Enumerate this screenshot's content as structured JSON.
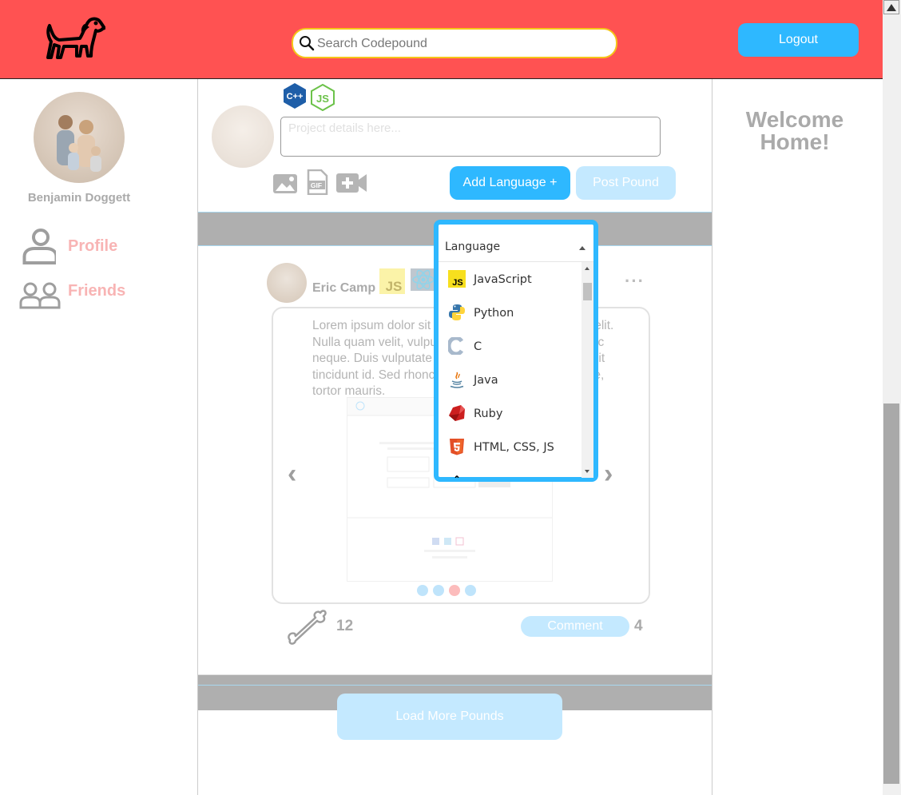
{
  "header": {
    "search_placeholder": "Search Codepound",
    "logout_label": "Logout"
  },
  "sidebar": {
    "user_name": "Benjamin Doggett",
    "items": [
      {
        "label": "Profile",
        "icon": "user-icon"
      },
      {
        "label": "Friends",
        "icon": "friends-icon"
      }
    ]
  },
  "composer": {
    "placeholder": "Project details here...",
    "add_language_label": "Add Language +",
    "post_label": "Post Pound",
    "selected_languages": [
      "C++",
      "JS"
    ]
  },
  "post": {
    "author": "Eric Camp",
    "badges": [
      "JS",
      "React"
    ],
    "text": "Lorem ipsum dolor sit amet, consectetur adipiscing elit. Nulla quam velit, vulputate eu pharetra nec, mattis ac neque. Duis vulputate commodo lectus, ac blandit elit tincidunt id. Sed rhoncus, tortor sed eleifend tristique, tortor mauris.",
    "likes": "12",
    "comment_label": "Comment",
    "comments": "4"
  },
  "feed": {
    "load_more_label": "Load More Pounds"
  },
  "right": {
    "welcome_line1": "Welcome",
    "welcome_line2": "Home!"
  },
  "dropdown": {
    "label": "Language",
    "options": [
      "JavaScript",
      "Python",
      "C",
      "Java",
      "Ruby",
      "HTML, CSS, JS"
    ]
  },
  "colors": {
    "header": "#ff5252",
    "accent": "#2eb8ff",
    "accent_light": "#c4e9ff",
    "search_border": "#f5c518"
  }
}
